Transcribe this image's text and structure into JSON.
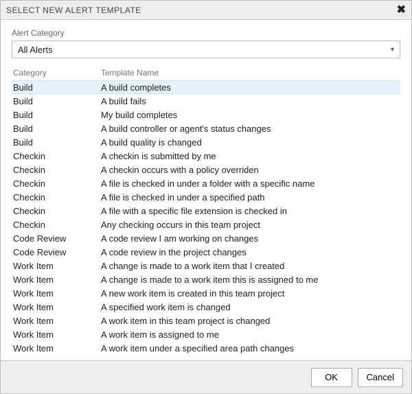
{
  "dialog": {
    "title": "SELECT NEW ALERT TEMPLATE",
    "close_glyph": "✖"
  },
  "filter": {
    "label": "Alert Category",
    "value": "All Alerts",
    "chevron": "▾"
  },
  "columns": {
    "category": "Category",
    "template": "Template Name"
  },
  "rows": [
    {
      "category": "Build",
      "name": "A build completes",
      "selected": true
    },
    {
      "category": "Build",
      "name": "A build fails",
      "selected": false
    },
    {
      "category": "Build",
      "name": "My build completes",
      "selected": false
    },
    {
      "category": "Build",
      "name": "A build controller or agent's status changes",
      "selected": false
    },
    {
      "category": "Build",
      "name": "A build quality is changed",
      "selected": false
    },
    {
      "category": "Checkin",
      "name": "A checkin is submitted by me",
      "selected": false
    },
    {
      "category": "Checkin",
      "name": "A checkin occurs with a policy overriden",
      "selected": false
    },
    {
      "category": "Checkin",
      "name": "A file is checked in under a folder with a specific name",
      "selected": false
    },
    {
      "category": "Checkin",
      "name": "A file is checked in under a specified path",
      "selected": false
    },
    {
      "category": "Checkin",
      "name": "A file with a specific file extension is checked in",
      "selected": false
    },
    {
      "category": "Checkin",
      "name": "Any checking occurs in this team project",
      "selected": false
    },
    {
      "category": "Code Review",
      "name": "A code review I am working on changes",
      "selected": false
    },
    {
      "category": "Code Review",
      "name": "A code review in the project changes",
      "selected": false
    },
    {
      "category": "Work Item",
      "name": "A change is made to a work item that I created",
      "selected": false
    },
    {
      "category": "Work Item",
      "name": "A change is made to a work item this is assigned to me",
      "selected": false
    },
    {
      "category": "Work Item",
      "name": "A new work item is created in this team project",
      "selected": false
    },
    {
      "category": "Work Item",
      "name": "A specified work item is changed",
      "selected": false
    },
    {
      "category": "Work Item",
      "name": "A work item in this team project is changed",
      "selected": false
    },
    {
      "category": "Work Item",
      "name": "A work item is assigned to me",
      "selected": false
    },
    {
      "category": "Work Item",
      "name": "A work item under a specified area path changes",
      "selected": false
    }
  ],
  "buttons": {
    "ok": "OK",
    "cancel": "Cancel"
  }
}
